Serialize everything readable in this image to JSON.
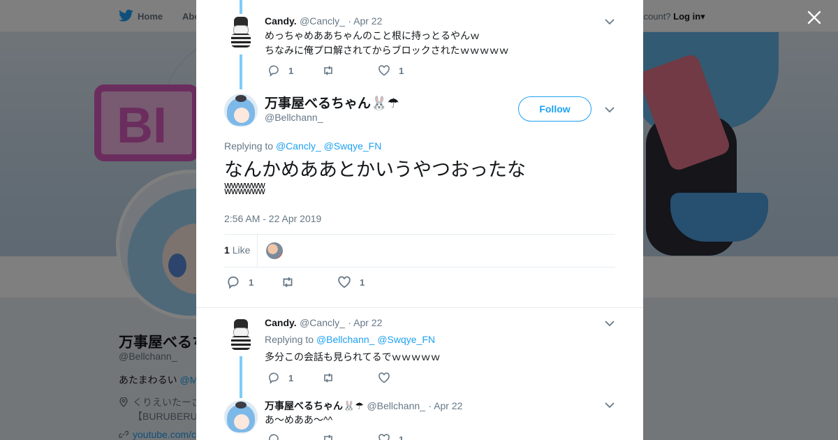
{
  "header": {
    "nav_home": "Home",
    "nav_about": "Abo",
    "account_prompt": "ccount?",
    "login": "Log in",
    "login_caret": "▾"
  },
  "profile": {
    "banner_logo_text": "BI",
    "name": "万事屋べるち",
    "handle": "@Bellchann_",
    "bio_text": "あたまわるい",
    "bio_mention": "@M",
    "location_line1": "くりえいたーさ",
    "location_line2": "【BURUBERU",
    "url": "youtube.com/c"
  },
  "modal": {
    "tweet1": {
      "name": "Candy.",
      "handle": "@Cancly_",
      "date": "· Apr 22",
      "line1": "めっちゃめああちゃんのこと根に持っとるやんｗ",
      "line2": "ちなみに俺プロ解されてからブロックされたｗｗｗｗｗ",
      "replies": "1",
      "retweets": "",
      "likes": "1"
    },
    "main": {
      "name": "万事屋べるちゃん🐰☂",
      "handle": "@Bellchann_",
      "follow": "Follow",
      "replying_prefix": "Replying to",
      "replying_to_1": "@Cancly_",
      "replying_to_2": "@Swqye_FN",
      "text_line1": "なんかめああとかいうやつおったな",
      "text_line2": "ʬʬʬʬʬʬ",
      "timestamp": "2:56 AM - 22 Apr 2019",
      "like_count": "1",
      "like_label": "Like",
      "replies": "1",
      "retweets": "",
      "likes": "1"
    },
    "tweet3": {
      "name": "Candy.",
      "handle": "@Cancly_",
      "date": "· Apr 22",
      "replying_prefix": "Replying to",
      "replying_to_1": "@Bellchann_",
      "replying_to_2": "@Swqye_FN",
      "text": "多分この会話も見られてるでｗｗｗｗｗ",
      "replies": "1",
      "retweets": "",
      "likes": ""
    },
    "tweet4": {
      "name": "万事屋べるちゃん🐰☂",
      "handle": "@Bellchann_",
      "date": "· Apr 22",
      "text": "あ〜めああ〜^^",
      "replies": "",
      "retweets": "",
      "likes": "1"
    }
  },
  "colors": {
    "link": "#1da1f2",
    "thread_line": "#7fccf7",
    "muted": "#657786"
  },
  "icons": [
    "twitter-bird-icon",
    "close-icon",
    "reply-icon",
    "retweet-icon",
    "like-icon",
    "chevron-down-icon",
    "location-pin-icon",
    "link-icon"
  ]
}
